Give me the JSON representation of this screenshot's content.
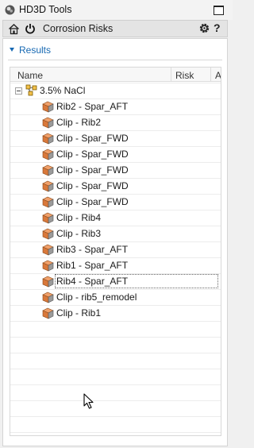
{
  "window": {
    "title": "HD3D Tools"
  },
  "toolbar": {
    "title": "Corrosion Risks",
    "help": "?"
  },
  "results": {
    "label": "Results",
    "columns": {
      "name": "Name",
      "risk": "Risk",
      "third": "A"
    }
  },
  "tree": {
    "root": {
      "label": "3.5% NaCl"
    },
    "items": [
      {
        "label": "Rib2 - Spar_AFT"
      },
      {
        "label": "Clip - Rib2"
      },
      {
        "label": "Clip - Spar_FWD"
      },
      {
        "label": "Clip - Spar_FWD"
      },
      {
        "label": "Clip - Spar_FWD"
      },
      {
        "label": "Clip - Spar_FWD"
      },
      {
        "label": "Clip - Spar_FWD"
      },
      {
        "label": "Clip - Rib4"
      },
      {
        "label": "Clip - Rib3"
      },
      {
        "label": "Rib3 - Spar_AFT"
      },
      {
        "label": "Rib1 - Spar_AFT"
      },
      {
        "label": "Rib4 - Spar_AFT",
        "focused": true
      },
      {
        "label": "Clip - rib5_remodel"
      },
      {
        "label": "Clip - Rib1"
      }
    ]
  },
  "colors": {
    "accent": "#1769b3",
    "part_orange": "#d9783a",
    "part_gray": "#8a8a8a"
  }
}
